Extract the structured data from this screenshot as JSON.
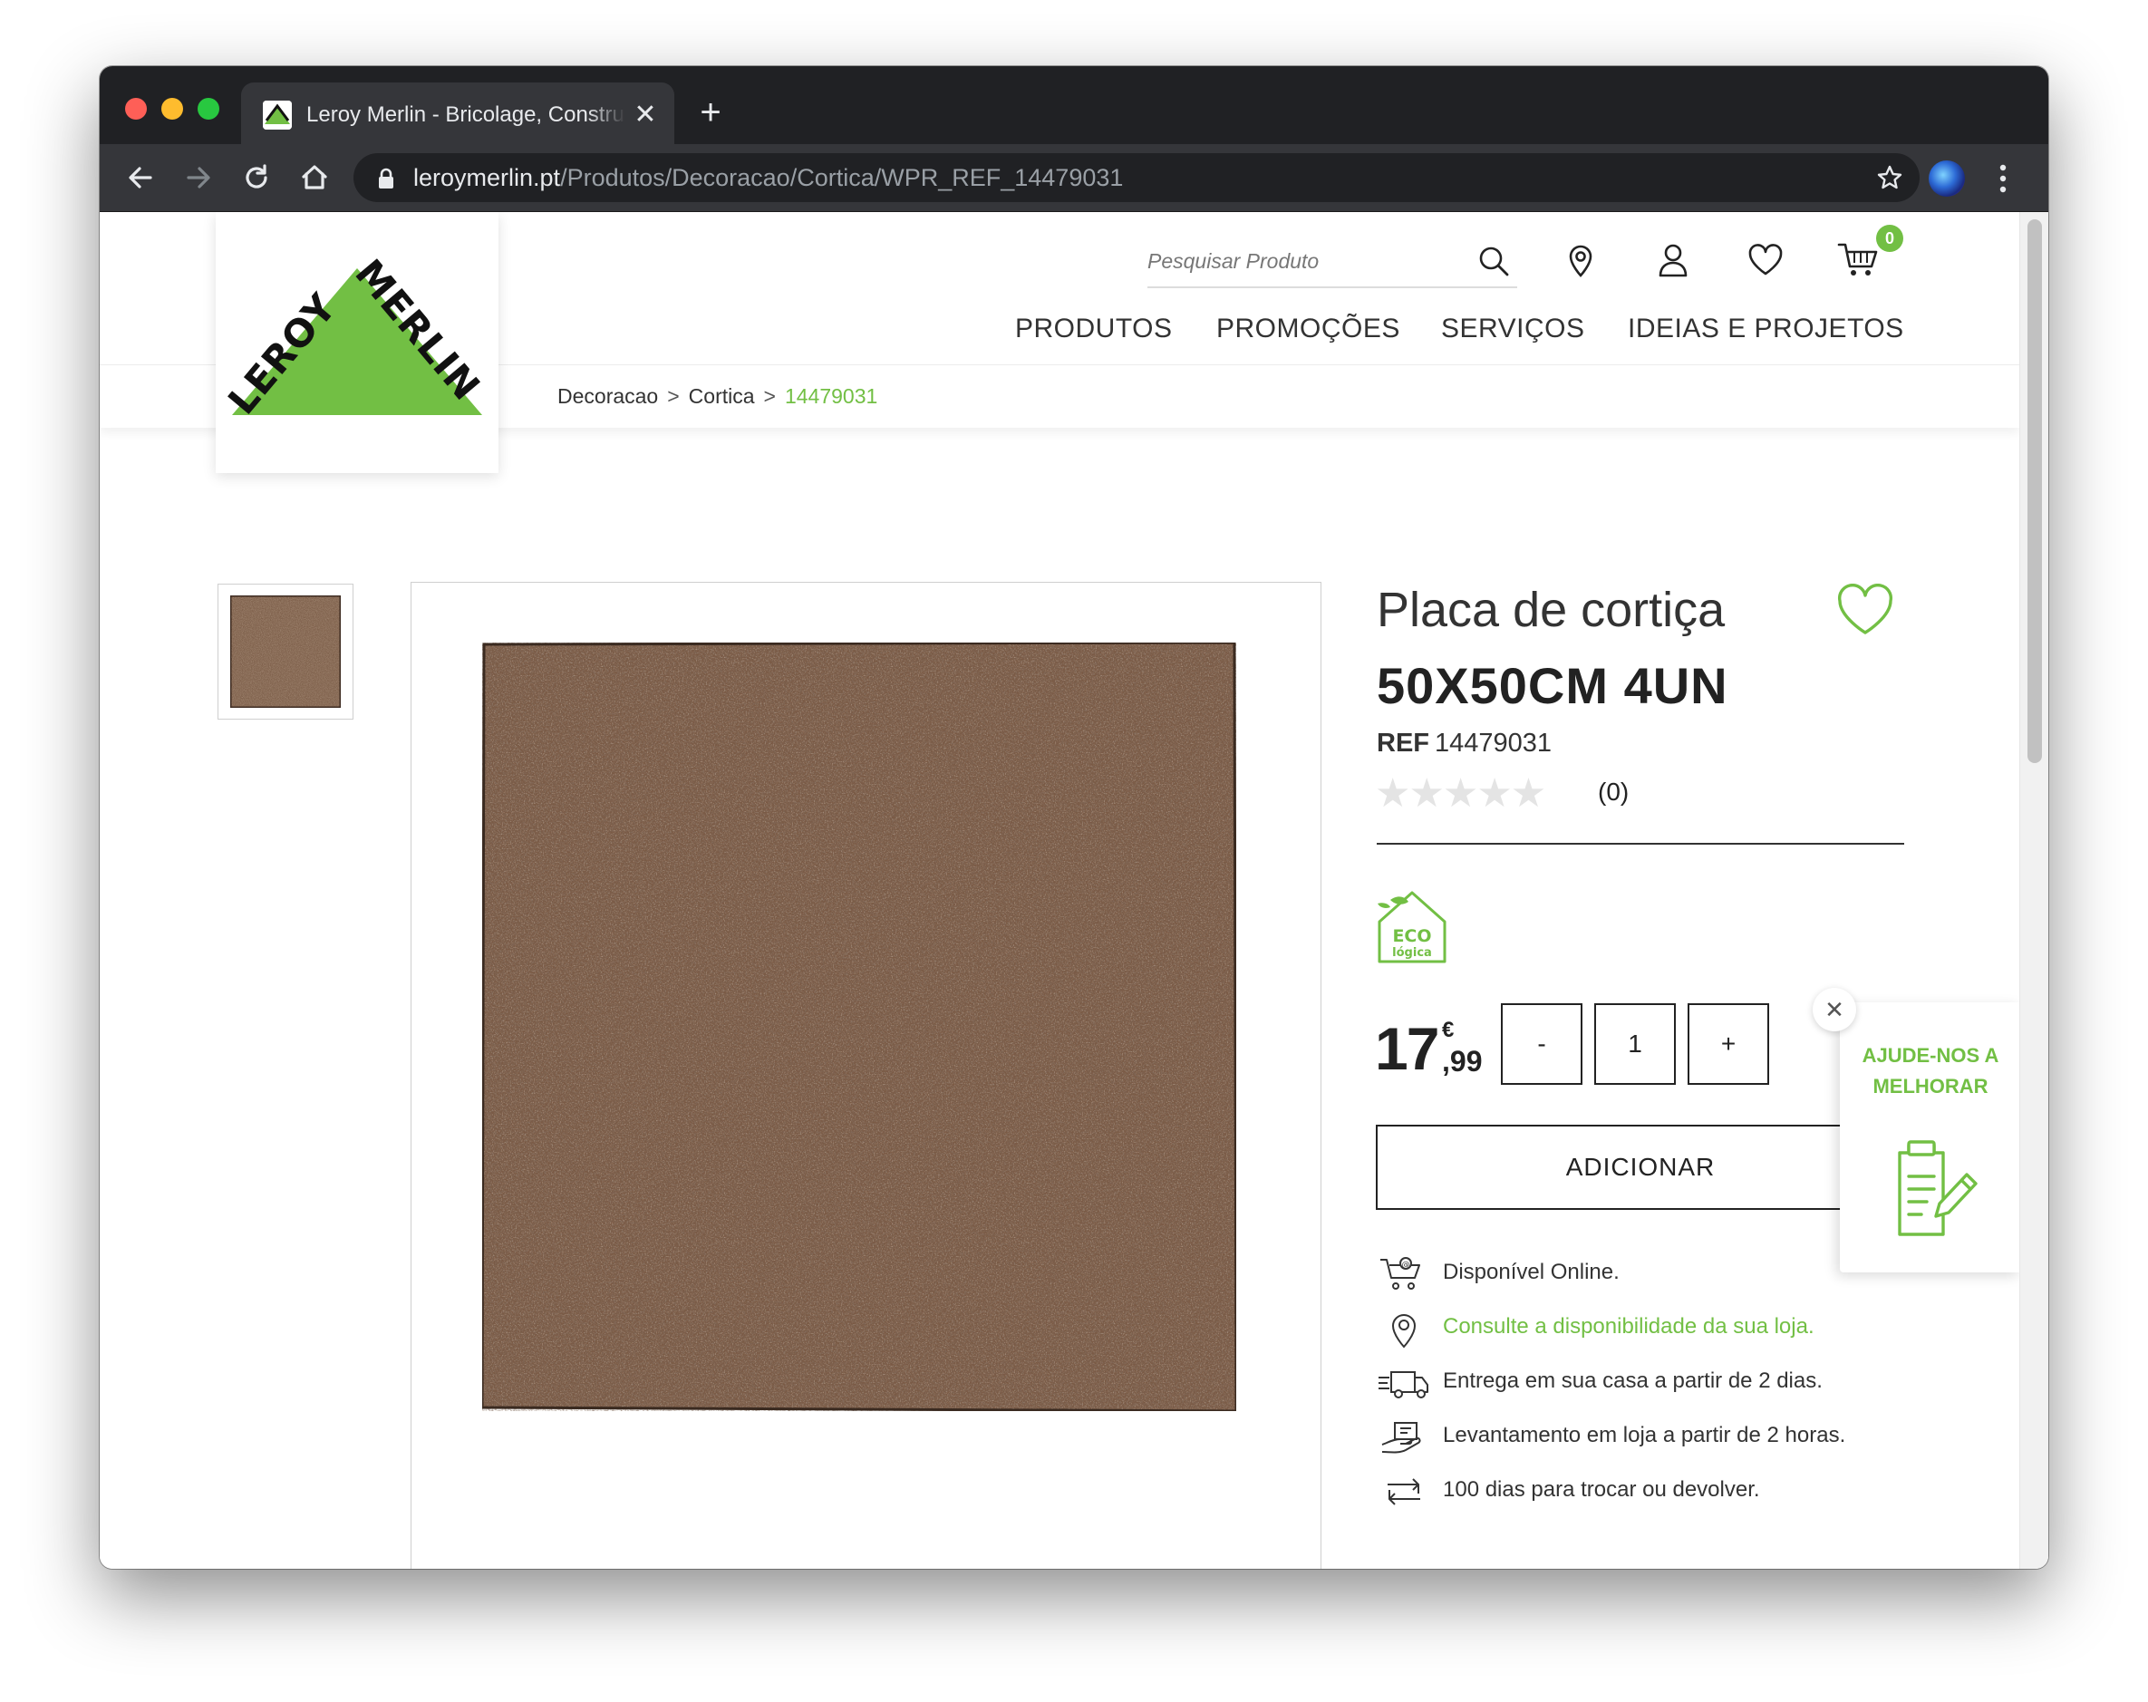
{
  "browser": {
    "tab_title": "Leroy Merlin - Bricolage, Construção, Decoração e Jardim",
    "tab_close": "✕",
    "new_tab": "+",
    "url_host": "leroymerlin.pt",
    "url_path": "/Produtos/Decoracao/Cortica/WPR_REF_14479031"
  },
  "header": {
    "search_placeholder": "Pesquisar Produto",
    "cart_count": "0",
    "nav": [
      "PRODUTOS",
      "PROMOÇÕES",
      "SERVIÇOS",
      "IDEIAS E PROJETOS"
    ],
    "logo_text": "LEROY MERLIN"
  },
  "breadcrumb": {
    "items": [
      "Decoracao",
      "Cortica"
    ],
    "separator": ">",
    "current": "14479031"
  },
  "product": {
    "title_line1": "Placa de cortiça",
    "title_line2": "50X50CM 4UN",
    "ref_label": "REF",
    "ref_value": "14479031",
    "stars": "★★★★★",
    "rating_value": 0,
    "rating_count": "(0)",
    "eco_badge": {
      "line1": "ECO",
      "line2": "lógica"
    },
    "price_int": "17",
    "price_currency": "€",
    "price_dec": ",99",
    "qty_minus": "-",
    "qty_value": "1",
    "qty_plus": "+",
    "add_button": "ADICIONAR"
  },
  "info": [
    {
      "icon": "cart-online-icon",
      "text": "Disponível Online."
    },
    {
      "icon": "location-pin-icon",
      "text": "Consulte a disponibilidade da sua loja."
    },
    {
      "icon": "delivery-truck-icon",
      "text": "Entrega em sua casa a partir de 2 dias."
    },
    {
      "icon": "store-pickup-icon",
      "text": "Levantamento em loja a partir de 2 horas."
    },
    {
      "icon": "return-arrows-icon",
      "text": "100 dias para trocar ou devolver."
    }
  ],
  "feedback": {
    "text_line1": "AJUDE-NOS A",
    "text_line2": "MELHORAR",
    "close": "✕"
  },
  "colors": {
    "brand_green": "#72bf44",
    "chrome_dark": "#202124",
    "chrome_toolbar": "#35363a",
    "cork_brown": "#7a5a45"
  }
}
